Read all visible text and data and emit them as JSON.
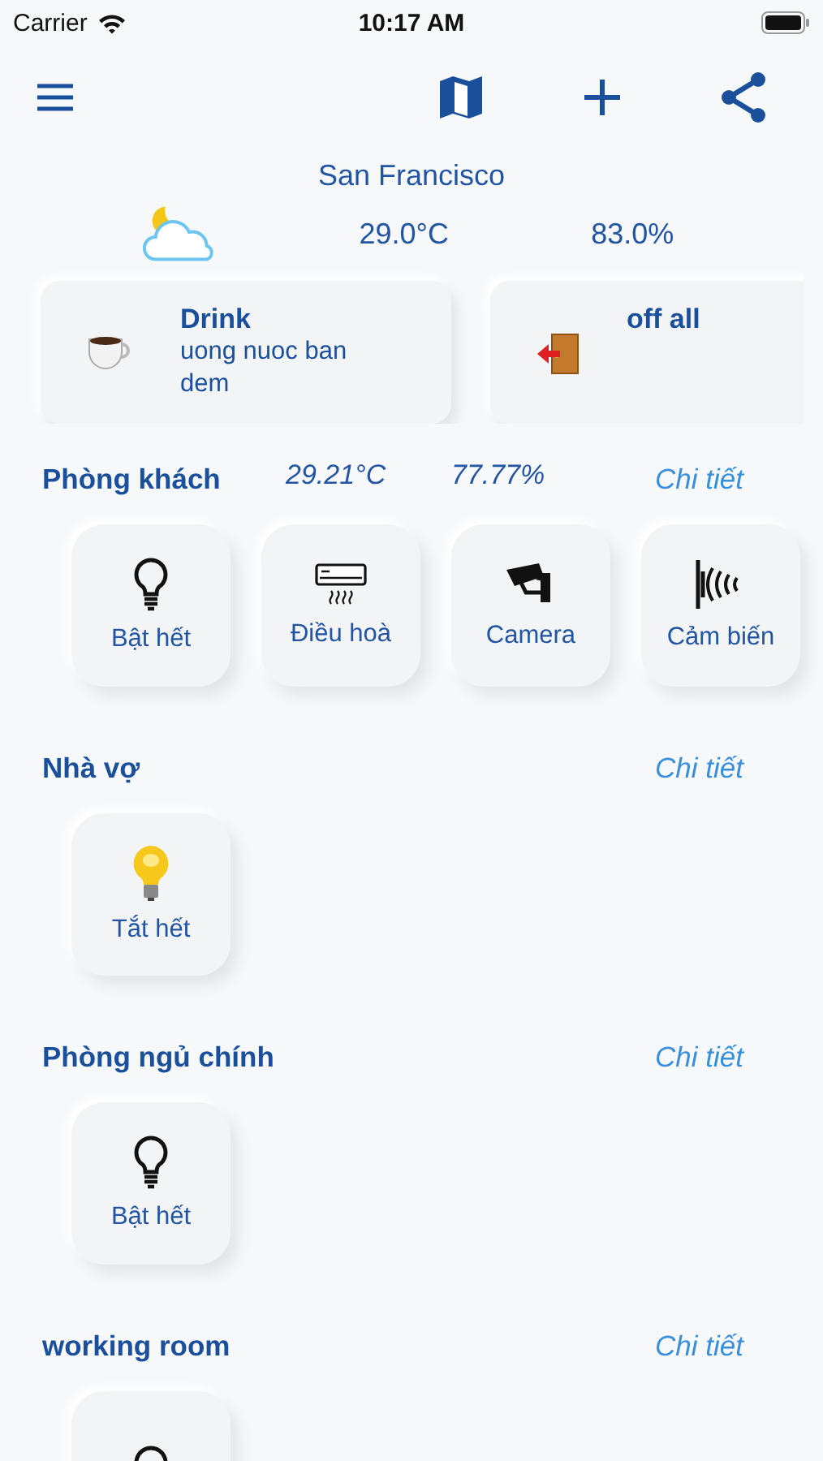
{
  "status_bar": {
    "carrier": "Carrier",
    "time": "10:17 AM"
  },
  "weather": {
    "city": "San Francisco",
    "temperature": "29.0°C",
    "humidity": "83.0%"
  },
  "scenes": [
    {
      "kind": "drink",
      "title": "Drink",
      "subtitle": "uong nuoc ban dem"
    },
    {
      "kind": "exit",
      "title": "off all"
    }
  ],
  "rooms": [
    {
      "name": "Phòng khách",
      "temperature": "29.21°C",
      "humidity": "77.77%",
      "detail_link": "Chi tiết",
      "devices": [
        {
          "kind": "bulb-off",
          "label": "Bật hết"
        },
        {
          "kind": "aircon",
          "label": "Điều hoà"
        },
        {
          "kind": "camera",
          "label": "Camera"
        },
        {
          "kind": "sensor",
          "label": "Cảm biến"
        }
      ]
    },
    {
      "name": "Nhà vợ",
      "detail_link": "Chi tiết",
      "devices": [
        {
          "kind": "bulb-on",
          "label": "Tắt hết"
        }
      ]
    },
    {
      "name": "Phòng ngủ chính",
      "detail_link": "Chi tiết",
      "devices": [
        {
          "kind": "bulb-off",
          "label": "Bật hết"
        }
      ]
    },
    {
      "name": "working room",
      "detail_link": "Chi tiết",
      "devices": [
        {
          "kind": "bulb-off"
        }
      ]
    }
  ]
}
